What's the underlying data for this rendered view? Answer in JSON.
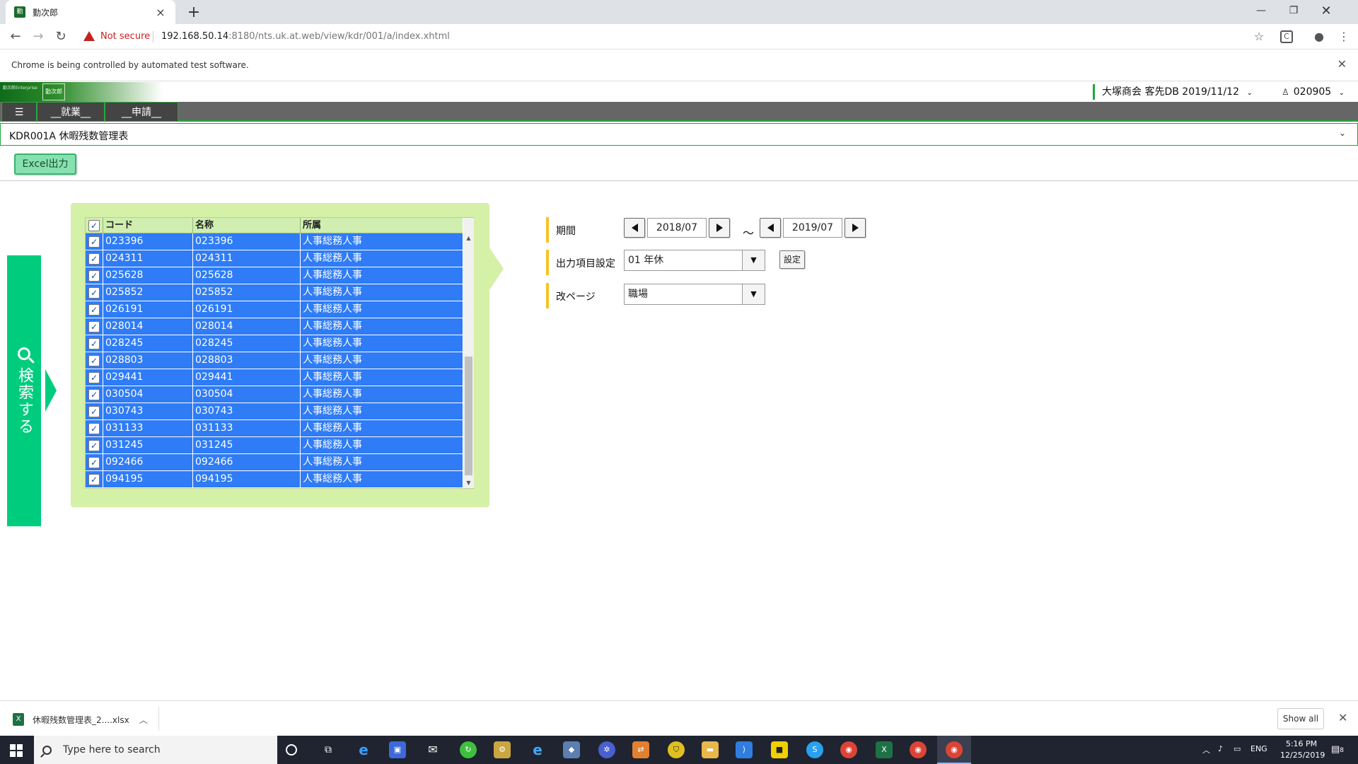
{
  "browser": {
    "tab_title": "勤次郎",
    "not_secure": "Not secure",
    "url_host": "192.168.50.14",
    "url_rest": ":8180/nts.uk.at.web/view/kdr/001/a/index.xhtml",
    "infobar": "Chrome is being controlled by automated test software."
  },
  "app": {
    "logo_text": "勤次郎Enterprise",
    "company": "大塚商会 客先DB 2019/11/12",
    "user": "020905",
    "menus": [
      "__就業__",
      "__申請__"
    ],
    "function_title": "KDR001A 休暇残数管理表",
    "excel_button": "Excel出力",
    "search_button": "検索する"
  },
  "grid": {
    "headers": [
      "コード",
      "名称",
      "所属"
    ],
    "rows": [
      {
        "code": "023396",
        "name": "023396",
        "dept": "人事総務人事"
      },
      {
        "code": "024311",
        "name": "024311",
        "dept": "人事総務人事"
      },
      {
        "code": "025628",
        "name": "025628",
        "dept": "人事総務人事"
      },
      {
        "code": "025852",
        "name": "025852",
        "dept": "人事総務人事"
      },
      {
        "code": "026191",
        "name": "026191",
        "dept": "人事総務人事"
      },
      {
        "code": "028014",
        "name": "028014",
        "dept": "人事総務人事"
      },
      {
        "code": "028245",
        "name": "028245",
        "dept": "人事総務人事"
      },
      {
        "code": "028803",
        "name": "028803",
        "dept": "人事総務人事"
      },
      {
        "code": "029441",
        "name": "029441",
        "dept": "人事総務人事"
      },
      {
        "code": "030504",
        "name": "030504",
        "dept": "人事総務人事"
      },
      {
        "code": "030743",
        "name": "030743",
        "dept": "人事総務人事"
      },
      {
        "code": "031133",
        "name": "031133",
        "dept": "人事総務人事"
      },
      {
        "code": "031245",
        "name": "031245",
        "dept": "人事総務人事"
      },
      {
        "code": "092466",
        "name": "092466",
        "dept": "人事総務人事"
      },
      {
        "code": "094195",
        "name": "094195",
        "dept": "人事総務人事"
      }
    ]
  },
  "form": {
    "period_label": "期間",
    "start_date": "2018/07",
    "tilde": "～",
    "end_date": "2019/07",
    "output_label": "出力項目設定",
    "output_value": "01 年休",
    "settings_button": "設定",
    "pagebreak_label": "改ページ",
    "pagebreak_value": "職場"
  },
  "downloads": {
    "file": "休暇残数管理表_2....xlsx",
    "show_all": "Show all"
  },
  "taskbar": {
    "search_placeholder": "Type here to search",
    "lang": "ENG",
    "time": "5:16 PM",
    "date": "12/25/2019",
    "notifications": "8"
  },
  "colors": {
    "accent_green": "#1eaa3a",
    "search_green": "#00cc7e",
    "panel_green": "#d5f0a7",
    "row_blue": "#2f7cf6",
    "label_marker": "#f5c423"
  }
}
